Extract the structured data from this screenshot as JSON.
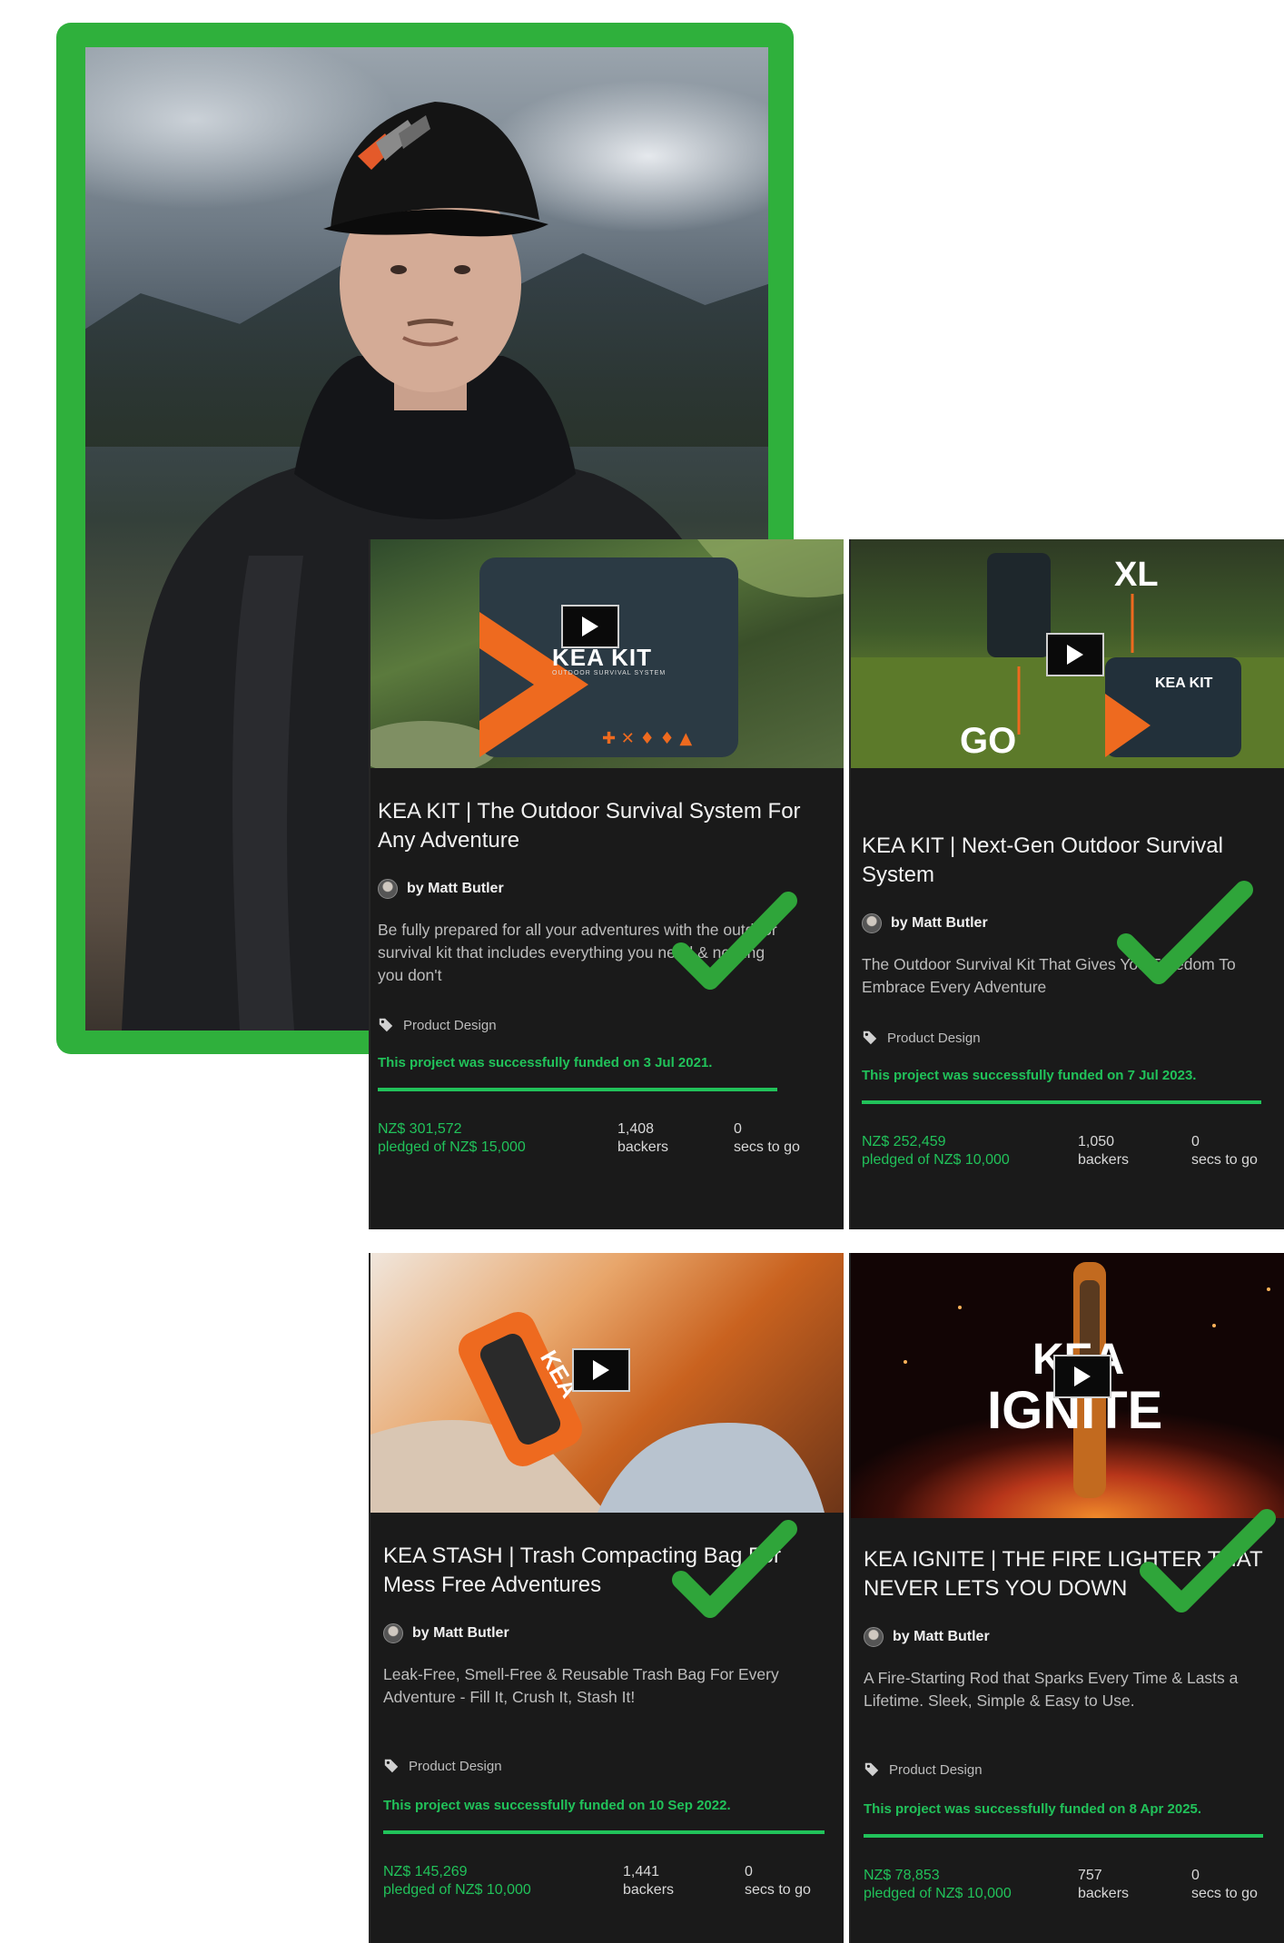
{
  "cards": [
    {
      "title": "KEA KIT | The Outdoor Survival System For Any Adventure",
      "creator": "by Matt Butler",
      "blurb": "Be fully prepared for all your adventures with the outdoor survival kit that includes everything you need & nothing you don't",
      "category": "Product Design",
      "funded_text": "This project was successfully funded on 3 Jul 2021.",
      "pledged": "NZ$ 301,572",
      "pledged_label": "pledged of NZ$ 15,000",
      "backers": "1,408",
      "backers_label": "backers",
      "secs": "0",
      "secs_label": "secs to go",
      "thumb_text": "KEA KIT",
      "thumb_subtext": "OUTDOOR SURVIVAL SYSTEM"
    },
    {
      "title": "KEA KIT | Next-Gen Outdoor Survival System",
      "creator": "by Matt Butler",
      "blurb": "The Outdoor Survival Kit That Gives You Freedom To Embrace Every Adventure",
      "category": "Product Design",
      "funded_text": "This project was successfully funded on 7 Jul 2023.",
      "pledged": "NZ$ 252,459",
      "pledged_label": "pledged of NZ$ 10,000",
      "backers": "1,050",
      "backers_label": "backers",
      "secs": "0",
      "secs_label": "secs to go",
      "thumb_xl": "XL",
      "thumb_go": "GO",
      "thumb_text": "KEA KIT"
    },
    {
      "title": "KEA STASH | Trash Compacting Bag For Mess Free Adventures",
      "creator": "by Matt Butler",
      "blurb": "Leak-Free, Smell-Free & Reusable Trash Bag For Every Adventure - Fill It, Crush It, Stash It!",
      "category": "Product Design",
      "funded_text": "This project was successfully funded on 10 Sep 2022.",
      "pledged": "NZ$ 145,269",
      "pledged_label": "pledged of NZ$ 10,000",
      "backers": "1,441",
      "backers_label": "backers",
      "secs": "0",
      "secs_label": "secs to go",
      "thumb_text": "KEA"
    },
    {
      "title": "KEA IGNITE | THE FIRE LIGHTER THAT NEVER LETS YOU DOWN",
      "creator": "by Matt Butler",
      "blurb": "A Fire-Starting Rod that Sparks Every Time & Lasts a Lifetime. Sleek, Simple & Easy to Use.",
      "category": "Product Design",
      "funded_text": "This project was successfully funded on 8 Apr 2025.",
      "pledged": "NZ$ 78,853",
      "pledged_label": "pledged of NZ$ 10,000",
      "backers": "757",
      "backers_label": "backers",
      "secs": "0",
      "secs_label": "secs to go",
      "thumb_text": "KEA",
      "thumb_subtext": "IGNITE"
    }
  ],
  "colors": {
    "frame": "#2fb03c",
    "card_bg": "#1a1a1a",
    "funded_green": "#21c25a",
    "kea_orange": "#ee6a1f"
  },
  "icons": [
    "play-icon",
    "tag-icon",
    "avatar",
    "checkmark-icon"
  ]
}
